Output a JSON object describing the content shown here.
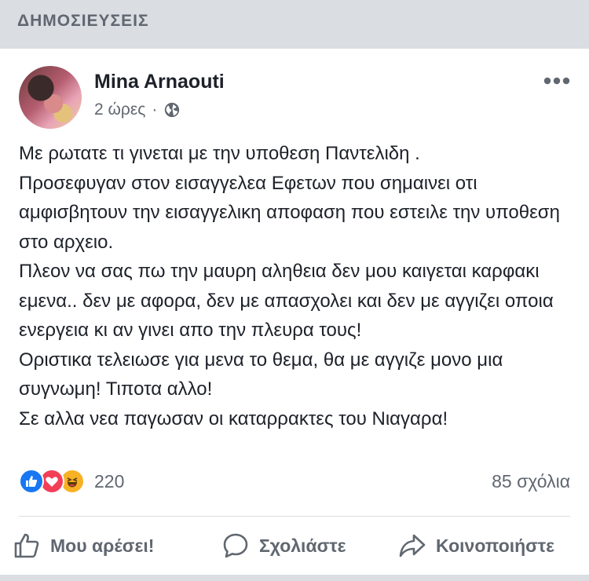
{
  "section": {
    "title": "ΔΗΜΟΣΙΕΥΣΕΙΣ"
  },
  "post": {
    "author": "Mina Arnaouti",
    "time": "2 ώρες",
    "separator": "·",
    "privacy_icon": "globe-icon",
    "text": "Με ρωτατε τι γινεται με την υποθεση Παντελιδη .\nΠροσεφυγαν  στον εισαγγελεα Εφετων που σημαινει οτι αμφισβητουν την εισαγγελικη αποφαση που εστειλε την υποθεση στο αρχειο.\nΠλεον να σας πω την μαυρη αληθεια δεν μου καιγεται καρφακι εμενα.. δεν με αφορα, δεν με απασχολει και δεν με αγγιζει οποια ενεργεια κι αν γινει απο την πλευρα τους!\nΟριστικα τελειωσε για μενα το θεμα, θα με αγγιζε μονο μια συγνωμη! Τιποτα αλλο!\nΣε αλλα νεα παγωσαν οι καταρρακτες του Νιαγαρα!"
  },
  "reactions": {
    "types": [
      "like-icon",
      "love-icon",
      "haha-icon"
    ],
    "count": "220",
    "comments": "85 σχόλια"
  },
  "actions": {
    "like_label": "Μου αρέσει!",
    "comment_label": "Σχολιάστε",
    "share_label": "Κοινοποιήστε"
  },
  "colors": {
    "background": "#dadde1",
    "card": "#ffffff",
    "text": "#1d2129",
    "secondary": "#606770",
    "like_blue": "#1877f2",
    "love_red": "#f33e58",
    "haha_yellow": "#f7b125"
  }
}
